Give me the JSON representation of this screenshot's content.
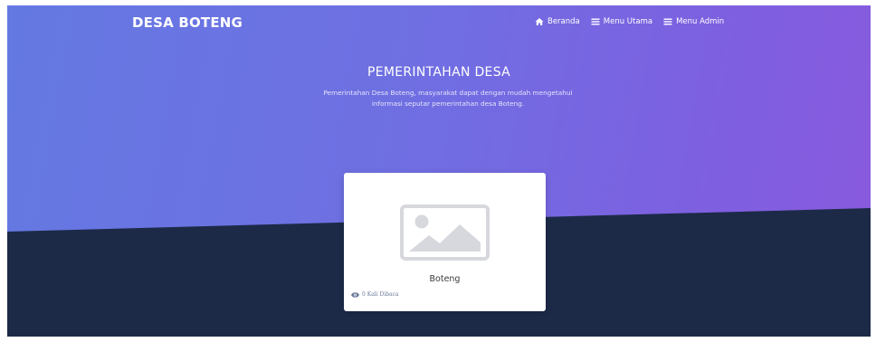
{
  "navbar": {
    "brand": "DESA BOTENG",
    "items": [
      {
        "label": "Beranda",
        "icon": "home-icon"
      },
      {
        "label": "Menu Utama",
        "icon": "menu-icon"
      },
      {
        "label": "Menu Admin",
        "icon": "menu-icon"
      }
    ]
  },
  "hero": {
    "title": "PEMERINTAHAN DESA",
    "description": "Pemerintahan Desa Boteng, masyarakat dapat dengan mudah mengetahui informasi seputar pemerintahan desa Boteng."
  },
  "cards": [
    {
      "title": "Boteng",
      "meta": "0 Kali Dibaca",
      "image_icon": "image-placeholder-icon",
      "meta_icon": "eye-icon"
    }
  ],
  "colors": {
    "gradient_start": "#6479e2",
    "gradient_end": "#8a5ade",
    "dark_band": "#1c2a48",
    "card_bg": "#ffffff",
    "placeholder": "#d6d8dd"
  }
}
